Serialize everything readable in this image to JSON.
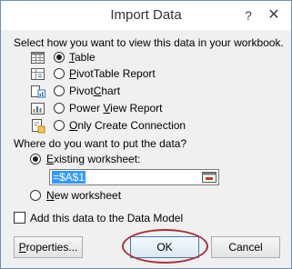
{
  "window": {
    "title": "Import Data",
    "help_glyph": "?",
    "close_glyph": "✕"
  },
  "view": {
    "prompt": "Select how you want to view this data in your workbook.",
    "selected": "Table",
    "options": [
      {
        "label": "Table",
        "icon": "table-icon"
      },
      {
        "label": "PivotTable Report",
        "icon": "pivottable-icon"
      },
      {
        "label": "PivotChart",
        "icon": "pivotchart-icon"
      },
      {
        "label": "Power View Report",
        "icon": "power-view-icon"
      },
      {
        "label": "Only Create Connection",
        "icon": "connection-icon"
      }
    ]
  },
  "destination": {
    "prompt": "Where do you want to put the data?",
    "selected": "Existing worksheet:",
    "existing_label": "Existing worksheet:",
    "range_value": "=$A$1",
    "new_label": "New worksheet"
  },
  "data_model": {
    "label": "Add this data to the Data Model",
    "checked": false
  },
  "buttons": {
    "properties": "Properties...",
    "ok": "OK",
    "cancel": "Cancel"
  },
  "colors": {
    "highlight_ellipse": "#a9323b",
    "selection": "#3399ff",
    "border": "#6e8fb5"
  }
}
